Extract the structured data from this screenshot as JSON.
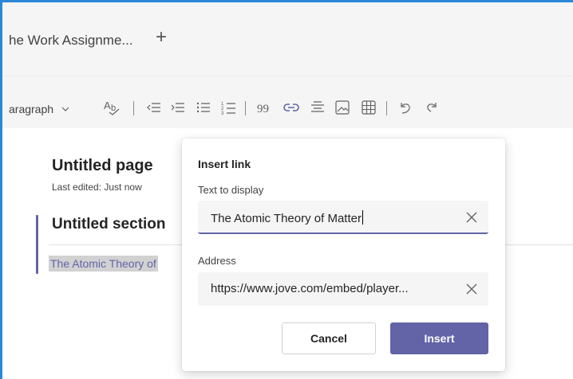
{
  "tabbar": {
    "tab_title": "he Work Assignme...",
    "add_tab": "+"
  },
  "toolbar": {
    "paragraph_style": "aragraph",
    "icons": [
      "chevron-down-icon",
      "spellcheck-icon",
      "decrease-indent-icon",
      "increase-indent-icon",
      "bulleted-list-icon",
      "numbered-list-icon",
      "quote-icon",
      "link-icon",
      "align-center-icon",
      "image-icon",
      "table-icon",
      "undo-icon",
      "redo-icon"
    ]
  },
  "page": {
    "title": "Untitled page",
    "last_edited": "Last edited: Just now",
    "section_title": "Untitled section",
    "selected_text": "The Atomic Theory of"
  },
  "dialog": {
    "title": "Insert link",
    "text_label": "Text to display",
    "text_value": "The Atomic Theory of Matter",
    "address_label": "Address",
    "address_value": "https://www.jove.com/embed/player...",
    "cancel_label": "Cancel",
    "insert_label": "Insert"
  },
  "colors": {
    "accent": "#6264a7",
    "window_border": "#2b88d8",
    "toolbar_bg": "#f5f5f5"
  }
}
